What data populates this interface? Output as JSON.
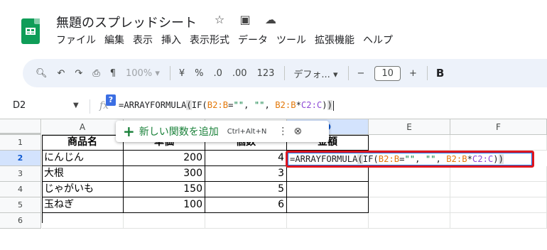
{
  "app": {
    "doc_title": "無題のスプレッドシート",
    "icons": [
      "star-icon",
      "folder-move-icon",
      "cloud-status-icon"
    ]
  },
  "menu": [
    "ファイル",
    "編集",
    "表示",
    "挿入",
    "表示形式",
    "データ",
    "ツール",
    "拡張機能",
    "ヘルプ"
  ],
  "toolbar": {
    "zoom": "100%",
    "currency": "¥",
    "percent": "%",
    "decrease_decimal": ".0",
    "increase_decimal": ".00",
    "number_format": "123",
    "font": "デフォ...",
    "minus": "−",
    "font_size": "10",
    "plus": "+",
    "bold": "B"
  },
  "formula_bar": {
    "cell_ref": "D2",
    "fx": "fx",
    "help_badge": "?",
    "formula_parts": [
      "=ARRAYFORMULA",
      "(",
      "IF(",
      "B2:B",
      "=",
      "\"\"",
      ", ",
      "\"\"",
      ", ",
      "B2:B",
      "*",
      "C2:C",
      ")",
      ")"
    ]
  },
  "function_popup": {
    "label": "新しい関数を追加",
    "shortcut": "Ctrl+Alt+N"
  },
  "grid": {
    "columns": [
      "A",
      "B",
      "C",
      "D",
      "E",
      "F"
    ],
    "selected_column": "D",
    "rows": [
      "1",
      "2",
      "3",
      "4",
      "5",
      "6"
    ],
    "selected_row": "2",
    "header_row": [
      "商品名",
      "単価",
      "個数",
      "金額"
    ],
    "data_rows": [
      {
        "name": "にんじん",
        "price": "200",
        "qty": "4"
      },
      {
        "name": "大根",
        "price": "300",
        "qty": "3"
      },
      {
        "name": "じゃがいも",
        "price": "150",
        "qty": "5"
      },
      {
        "name": "玉ねぎ",
        "price": "100",
        "qty": "6"
      }
    ]
  },
  "colors": {
    "accent": "#0b57d0",
    "highlight_border": "#e0161e",
    "ref_orange": "#e3780a",
    "ref_purple": "#8e4bd6",
    "string_green": "#0b8043"
  }
}
